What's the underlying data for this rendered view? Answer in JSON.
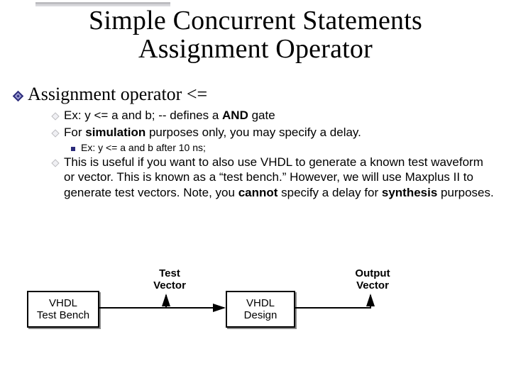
{
  "title_line1": "Simple Concurrent Statements",
  "title_line2": "Assignment Operator",
  "lvl1_text": "Assignment operator  <=",
  "bullets": {
    "b1_pre": "Ex:   y <= a and b;   --  defines a  ",
    "b1_bold": "AND",
    "b1_post": " gate",
    "b2_pre": "For ",
    "b2_bold": "simulation",
    "b2_post": " purposes only, you may specify a delay.",
    "b2_sub": "Ex: y <= a and b after 10 ns;",
    "b3_pre": "This is useful if you want to also use VHDL to generate a known test waveform or vector.  This is known as a “test bench.” However, we will use Maxplus II to generate test vectors. Note, you ",
    "b3_bold": "cannot",
    "b3_mid": " specify a delay for ",
    "b3_bold2": "synthesis",
    "b3_post": " purposes."
  },
  "diagram": {
    "box1_l1": "VHDL",
    "box1_l2": "Test Bench",
    "box2_l1": "VHDL",
    "box2_l2": "Design",
    "test_vector_l1": "Test",
    "test_vector_l2": "Vector",
    "output_vector_l1": "Output",
    "output_vector_l2": "Vector"
  }
}
